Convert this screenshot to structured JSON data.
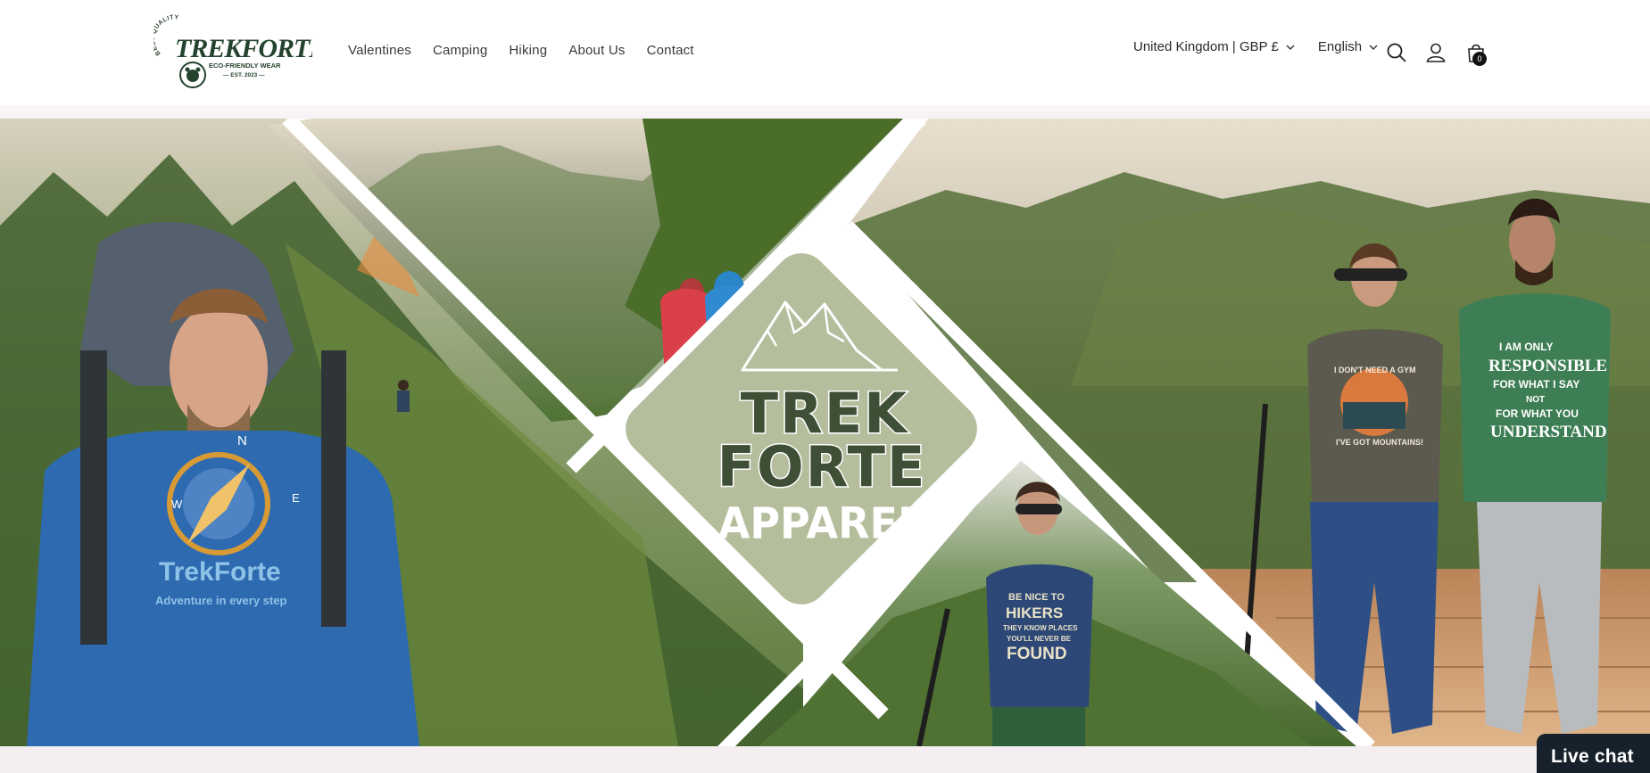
{
  "brand": {
    "arc_text": "BEST QUALITY",
    "name": "TREKFORTE",
    "tagline": "ECO-FRIENDLY WEAR",
    "established": "— EST. 2023 —"
  },
  "nav": {
    "items": [
      "Valentines",
      "Camping",
      "Hiking",
      "About Us",
      "Contact"
    ]
  },
  "header_utils": {
    "country_currency": "United Kingdom | GBP £",
    "language": "English",
    "cart_count": "0",
    "icons": [
      "search-icon",
      "account-icon",
      "cart-icon",
      "chevron-down-icon"
    ]
  },
  "hero": {
    "logo_line1": "TREK",
    "logo_line2": "FORTE",
    "logo_line3": "APPAREL",
    "left_shirt": {
      "brand": "TrekForte",
      "slogan": "Adventure in every step",
      "compass_n": "N",
      "compass_w": "W",
      "compass_e": "E"
    },
    "center_shirt": {
      "line1": "BE NICE TO",
      "line2": "HIKERS",
      "line3": "THEY KNOW PLACES",
      "line4": "YOU'LL NEVER BE",
      "line5": "FOUND"
    },
    "right_shirt_1": {
      "top": "I DON'T NEED A GYM",
      "bottom": "I'VE GOT MOUNTAINS!"
    },
    "right_shirt_2": {
      "line1": "I AM ONLY",
      "line2": "RESPONSIBLE",
      "line3": "FOR WHAT I SAY",
      "line4": "NOT",
      "line5": "FOR WHAT YOU",
      "line6": "UNDERSTAND"
    },
    "colors": {
      "sage": "#b4bd9c",
      "dark_green": "#3e4f36",
      "forest": "#4c6b33",
      "sky": "#dcd6c4",
      "deck": "#c6966a",
      "shirt_blue": "#2e6ab0"
    }
  },
  "live_chat": {
    "label": "Live chat"
  }
}
